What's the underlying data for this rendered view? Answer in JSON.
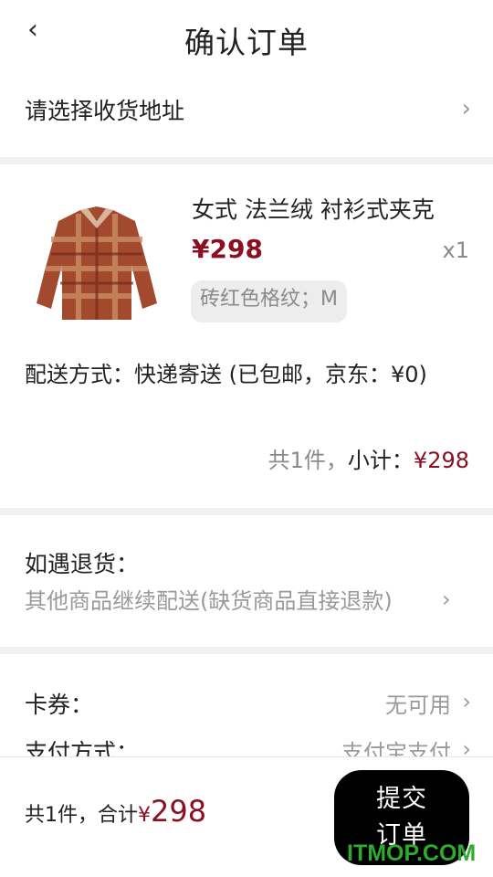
{
  "header": {
    "title": "确认订单",
    "back_icon": "‹"
  },
  "address": {
    "placeholder": "请选择收货地址"
  },
  "product": {
    "name": "女式 法兰绒 衬衫式夹克",
    "price": "¥298",
    "quantity": "x1",
    "spec": "砖红色格纹；M",
    "shipping": "配送方式：快递寄送 (已包邮，京东：¥0)",
    "count_text": "共1件，",
    "subtotal_label": "小计：",
    "subtotal_amount": "¥298"
  },
  "returns": {
    "label": "如遇退货：",
    "value": "其他商品继续配送(缺货商品直接退款)"
  },
  "coupon": {
    "label": "卡券：",
    "value": "无可用"
  },
  "payment": {
    "label": "支付方式：",
    "value": "支付宝支付"
  },
  "footer": {
    "total_prefix": "共1件，合计",
    "currency": "¥",
    "total_amount": "298",
    "submit_line1": "提交",
    "submit_line2": "订单"
  },
  "watermark": "ITMOP.COM",
  "colors": {
    "accent": "#8a0f22",
    "muted": "#9a9a9a",
    "button": "#000000"
  }
}
